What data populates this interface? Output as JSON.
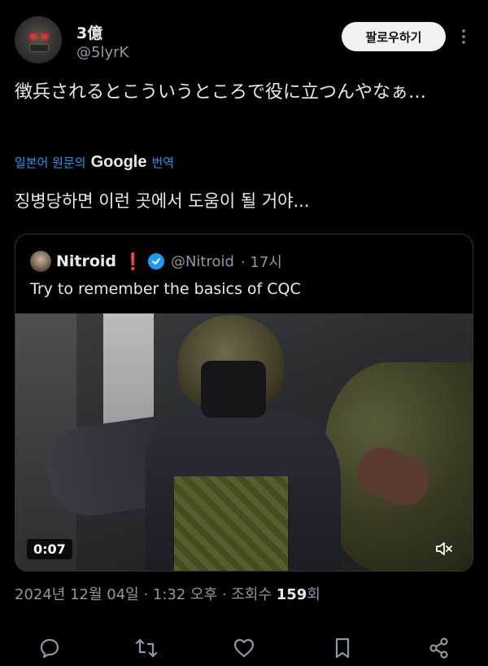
{
  "user": {
    "name": "3億",
    "handle": "@5lyrK"
  },
  "follow_button": "팔로우하기",
  "tweet": {
    "text": "徴兵されるとこういうところで役に立つんやなぁ…",
    "translate_prefix": "일본어 원문의",
    "translate_brand": "Google",
    "translate_suffix": "번역",
    "translated": "징병당하면 이런 곳에서 도움이 될 거야..."
  },
  "quote": {
    "name": "Nitroid",
    "alert": "❗",
    "handle": "@Nitroid",
    "time": "· 17시",
    "text": "Try to remember the basics of CQC",
    "video_duration": "0:07"
  },
  "meta": {
    "timestamp": "2024년 12월 04일 · 1:32 오후 · 조회수",
    "views": "159",
    "views_suffix": "회"
  },
  "icons": {
    "reply": "reply-icon",
    "retweet": "retweet-icon",
    "like": "like-icon",
    "bookmark": "bookmark-icon",
    "share": "share-icon",
    "verified": "verified-badge-icon",
    "mute": "mute-icon"
  },
  "colors": {
    "background": "#000000",
    "text": "#e7e9ea",
    "muted": "#8b98a5",
    "link": "#1d9bf0",
    "verified": "#1d9bf0"
  }
}
